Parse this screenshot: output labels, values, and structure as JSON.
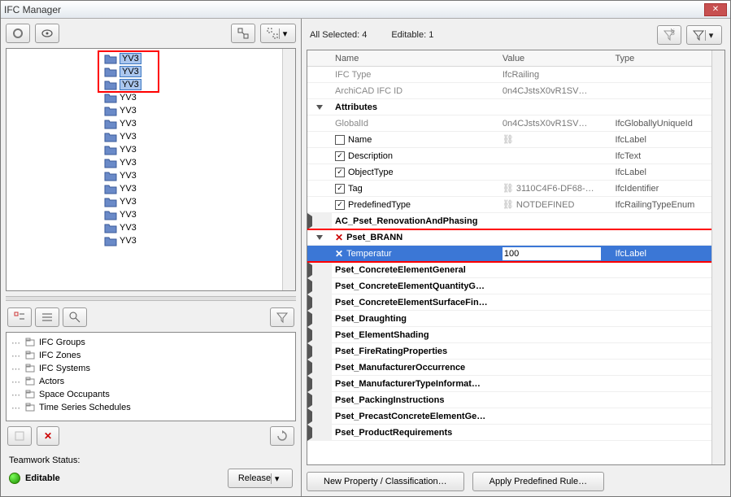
{
  "window": {
    "title": "IFC Manager"
  },
  "status": {
    "allSelectedLabel": "All Selected:",
    "allSelected": "4",
    "editableLabel": "Editable:",
    "editable": "1"
  },
  "treeItems": [
    {
      "label": "YV3",
      "hl": true
    },
    {
      "label": "YV3",
      "hl": true
    },
    {
      "label": "YV3",
      "hl": true
    },
    {
      "label": "YV3"
    },
    {
      "label": "YV3"
    },
    {
      "label": "YV3"
    },
    {
      "label": "YV3"
    },
    {
      "label": "YV3"
    },
    {
      "label": "YV3"
    },
    {
      "label": "YV3"
    },
    {
      "label": "YV3"
    },
    {
      "label": "YV3"
    },
    {
      "label": "YV3"
    },
    {
      "label": "YV3"
    },
    {
      "label": "YV3"
    }
  ],
  "lowerTree": {
    "items": [
      "IFC Groups",
      "IFC Zones",
      "IFC Systems",
      "Actors",
      "Space Occupants",
      "Time Series Schedules"
    ]
  },
  "teamwork": {
    "label": "Teamwork Status:",
    "status": "Editable",
    "releaseBtn": "Release"
  },
  "headers": {
    "name": "Name",
    "value": "Value",
    "type": "Type"
  },
  "props": {
    "ifcType": {
      "name": "IFC Type",
      "value": "IfcRailing"
    },
    "archicadId": {
      "name": "ArchiCAD IFC ID",
      "value": "0n4CJstsX0vR1SV…"
    },
    "attributesLabel": "Attributes",
    "globalId": {
      "name": "GlobalId",
      "value": "0n4CJstsX0vR1SV…",
      "type": "IfcGloballyUniqueId"
    },
    "name": {
      "name": "Name",
      "type": "IfcLabel"
    },
    "description": {
      "name": "Description",
      "type": "IfcText"
    },
    "objectType": {
      "name": "ObjectType",
      "type": "IfcLabel"
    },
    "tag": {
      "name": "Tag",
      "value": "3110C4F6-DF68-…",
      "type": "IfcIdentifier"
    },
    "predefinedType": {
      "name": "PredefinedType",
      "value": "NOTDEFINED",
      "type": "IfcRailingTypeEnum"
    },
    "psets": [
      "AC_Pset_RenovationAndPhasing"
    ],
    "brann": {
      "label": "Pset_BRANN",
      "row": {
        "name": "Temperatur",
        "value": "100",
        "type": "IfcLabel"
      }
    },
    "morePsets": [
      "Pset_ConcreteElementGeneral",
      "Pset_ConcreteElementQuantityG…",
      "Pset_ConcreteElementSurfaceFin…",
      "Pset_Draughting",
      "Pset_ElementShading",
      "Pset_FireRatingProperties",
      "Pset_ManufacturerOccurrence",
      "Pset_ManufacturerTypeInformat…",
      "Pset_PackingInstructions",
      "Pset_PrecastConcreteElementGe…",
      "Pset_ProductRequirements"
    ]
  },
  "buttons": {
    "newProp": "New Property / Classification…",
    "applyRule": "Apply Predefined Rule…"
  }
}
